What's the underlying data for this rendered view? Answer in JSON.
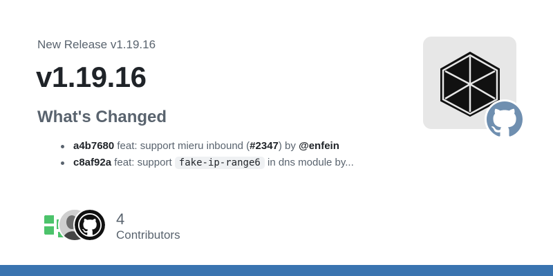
{
  "release": {
    "eyebrow": "New Release v1.19.16",
    "title": "v1.19.16",
    "section_heading": "What's Changed",
    "changes": [
      {
        "sha": "a4b7680",
        "text_before": "feat: support mieru inbound (",
        "ref": "#2347",
        "text_after": ") by ",
        "user": "@enfein"
      },
      {
        "sha": "c8af92a",
        "text_before": "feat: support ",
        "code": "fake-ip-range6",
        "text_after": " in dns module by..."
      }
    ]
  },
  "contributors": {
    "count": "4",
    "label": "Contributors",
    "avatars": [
      "avatar-green-pattern",
      "avatar-gray-photo",
      "github-icon"
    ]
  },
  "colors": {
    "accent_bar": "#3a74b0",
    "muted_text": "#59636e",
    "strong_text": "#1f2328",
    "logo_bg": "#e7e7e7",
    "github_badge": "#6f8fb0"
  },
  "icons": {
    "repo_logo": "hexagon-cube-icon",
    "badge": "github-icon"
  }
}
